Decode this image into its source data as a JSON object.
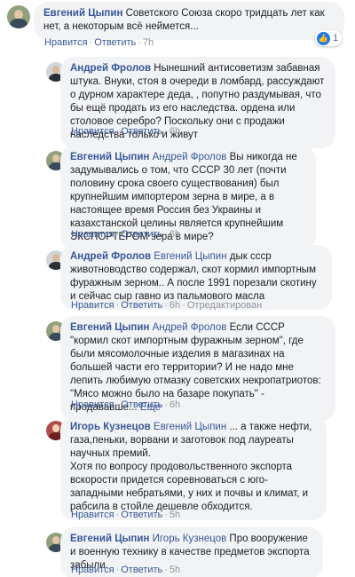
{
  "labels": {
    "like": "Нравится",
    "reply": "Ответить",
    "edited": "Отредактирован",
    "more": "Еще"
  },
  "comments": [
    {
      "author": "Евгений Цыпин",
      "text": "Советского Союза скоро тридцать лет как нет, а некоторым всё неймется...",
      "time": "7h",
      "reactions": {
        "icon": "like-icon",
        "count": "1"
      }
    },
    {
      "author": "Андрей Фролов",
      "text": "Нынешний антисоветизм забавная штука. Внуки, стоя в очереди в ломбард, рассуждают о дурном характере деда, , попутно раздумывая, что бы ещё продать из его наследства. ордена или столовое серебро? Поскольку они с продажи наследства только и живут",
      "time": "6h"
    },
    {
      "author": "Евгений Цыпин",
      "mention": "Андрей Фролов",
      "text": "Вы никогда не задумывались о том, что СССР 30 лет (почти половину срока своего существования) был крупнейшим импортером зерна в мире, а в настоящее время Россия без Украины и казахстанской целины является крупнейшим ЭКСПОРТЕРОМ зера в мире?",
      "time": "6h"
    },
    {
      "author": "Андрей Фролов",
      "mention": "Евгений Цыпин",
      "text": "дык ссср животноводство содержал, скот кормил импортным фуражным зерном.. А после 1991 порезали скотину и сейчас сыр гавно из пальмового масла",
      "time": "6h",
      "edited": true
    },
    {
      "author": "Евгений Цыпин",
      "mention": "Андрей Фролов",
      "text": "Если СССР \"кормил скот импортным фуражным зерном\", где были мясомолочные изделия в магазинах на большей части его территории? И не надо мне лепить любимую отмазку советских некропатриотов: \"Мясо можно было на базаре покупать\" - продававше...",
      "time": "6h"
    },
    {
      "author": "Игорь Кузнецов",
      "mention": "Евгений Цыпин",
      "text": "... а также нефти, газа,пеньки, ворвани и заготовок под лауреаты научных премий.",
      "text2": "Хотя по вопросу продовольственного экспорта вскорости придется соревноваться с юго-западными небратьями, у них и почвы и климат, и рабсила в стойле дешевле обходится.",
      "time": "5h"
    },
    {
      "author": "Евгений Цыпин",
      "mention": "Игорь Кузнецов",
      "text": "Про вооружение и военную технику в качестве предметов экспорта забыли.",
      "time": "5h"
    }
  ]
}
